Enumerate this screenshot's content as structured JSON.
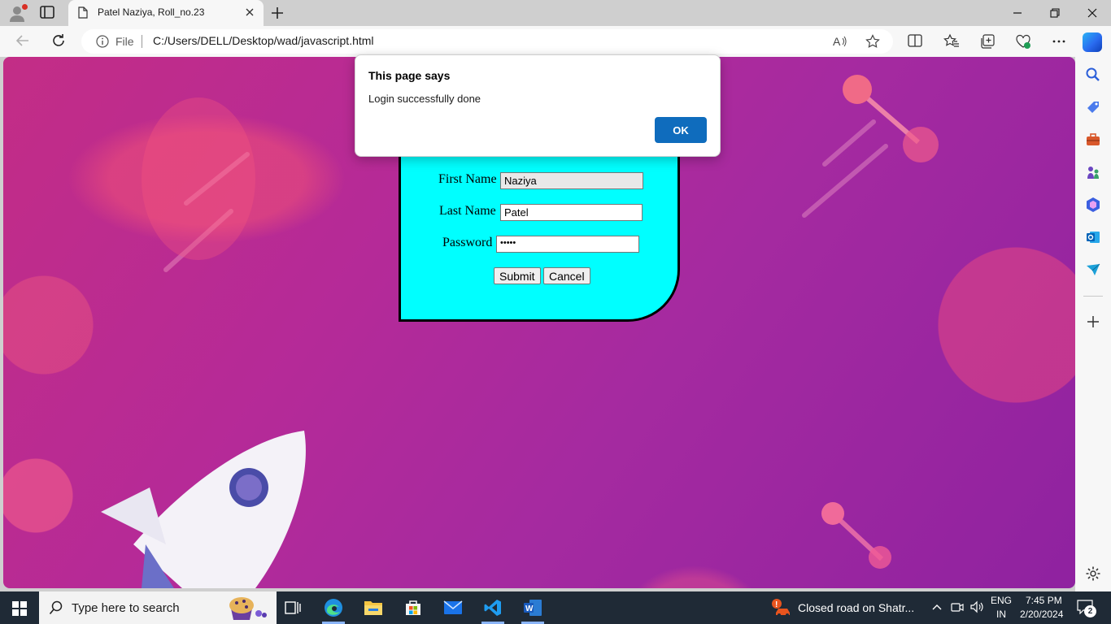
{
  "browser": {
    "tab_title": "Patel Naziya, Roll_no.23",
    "address_scheme_label": "File",
    "address_url": "C:/Users/DELL/Desktop/wad/javascript.html"
  },
  "form": {
    "first_name_label": "First Name",
    "first_name_value": "Naziya",
    "last_name_label": "Last Name",
    "last_name_value": "Patel",
    "password_label": "Password",
    "password_mask": "•••••",
    "submit_label": "Submit",
    "cancel_label": "Cancel",
    "background_color": "#00ffff"
  },
  "dialog": {
    "title": "This page says",
    "message": "Login successfully done",
    "ok_label": "OK",
    "ok_color": "#0f6cbd"
  },
  "taskbar": {
    "search_placeholder": "Type here to search",
    "news_text": "Closed road on Shatr...",
    "language_top": "ENG",
    "language_bottom": "IN",
    "time": "7:45 PM",
    "date": "2/20/2024",
    "notification_count": "2"
  }
}
